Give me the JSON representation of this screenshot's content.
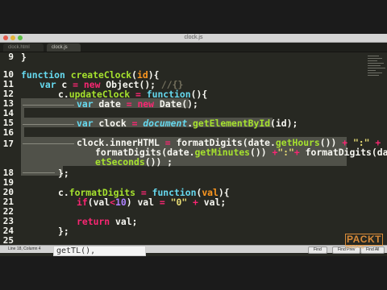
{
  "window": {
    "title": "clock.js"
  },
  "tabs": [
    {
      "label": "clock.html",
      "active": false
    },
    {
      "label": "clock.js",
      "active": true
    }
  ],
  "gutter": {
    "lines": [
      "9",
      "10",
      "11",
      "12",
      "13",
      "14",
      "15",
      "16",
      "17",
      "",
      "",
      "18",
      "19",
      "20",
      "21",
      "22",
      "23",
      "24",
      "25"
    ]
  },
  "code": {
    "l9": "}",
    "l10_kw": "function",
    "l10_fn": "createClock",
    "l10_p": "(",
    "l10_param": "id",
    "l10_end": "){",
    "l11_kw": "var",
    "l11_a": " c ",
    "l11_op": "=",
    "l11_new": "new",
    "l11_b": " Object(); ",
    "l11_cmt": "//{}",
    "l12_a": "c.",
    "l12_fn": "updateClock",
    "l12_op": " = ",
    "l12_kw": "function",
    "l12_end": "(){",
    "l13_kw": "var",
    "l13_a": " date ",
    "l13_op": "=",
    "l13_new": "new",
    "l13_b": " Date();",
    "l15_kw": "var",
    "l15_a": " clock ",
    "l15_op": "=",
    "l15_doc": "document",
    "l15_dot": ".",
    "l15_fn": "getElementById",
    "l15_end": "(id);",
    "l17_a": "clock.innerHTML ",
    "l17_op": "=",
    "l17_b": " formatDigits(date.",
    "l17_fn": "getHours",
    "l17_c": "()) ",
    "l17_op2": "+",
    "l17_str": "\":\"",
    "l17_op3": "+",
    "l17w1_a": "formatDigits(date.",
    "l17w1_fn": "getMinutes",
    "l17w1_b": "()) ",
    "l17w1_op": "+",
    "l17w1_str": "\":\"",
    "l17w1_op2": "+",
    "l17w1_c": " formatDigits(date.",
    "l17w1_g": "g",
    "l17w2_fn": "etSeconds",
    "l17w2_b": "()) ;",
    "l18": "};",
    "l20_a": "c.",
    "l20_fn": "formatDigits",
    "l20_op": " = ",
    "l20_kw": "function",
    "l20_p": "(",
    "l20_param": "val",
    "l20_end": "){",
    "l21_kw": "if",
    "l21_a": "(val",
    "l21_op": "<",
    "l21_num": "10",
    "l21_b": ") val ",
    "l21_op2": "=",
    "l21_str": "\"0\"",
    "l21_op3": "+",
    "l21_c": " val;",
    "l23_kw": "return",
    "l23_a": " val;",
    "l24": "};"
  },
  "autocomplete": {
    "text": "getTL(),"
  },
  "status": {
    "left": "Line 18, Column 4",
    "buttons": [
      "Find",
      "Find Prev",
      "Find All"
    ]
  },
  "logo": {
    "text": "PACKT",
    "sub": "publishing"
  },
  "colors": {
    "editor_bg": "#272822",
    "keyword": "#66d9ef",
    "function": "#a6e22e",
    "operator": "#f92672",
    "string": "#e6db74",
    "number": "#ae81ff",
    "comment": "#75715e",
    "logo": "#d88a38"
  }
}
